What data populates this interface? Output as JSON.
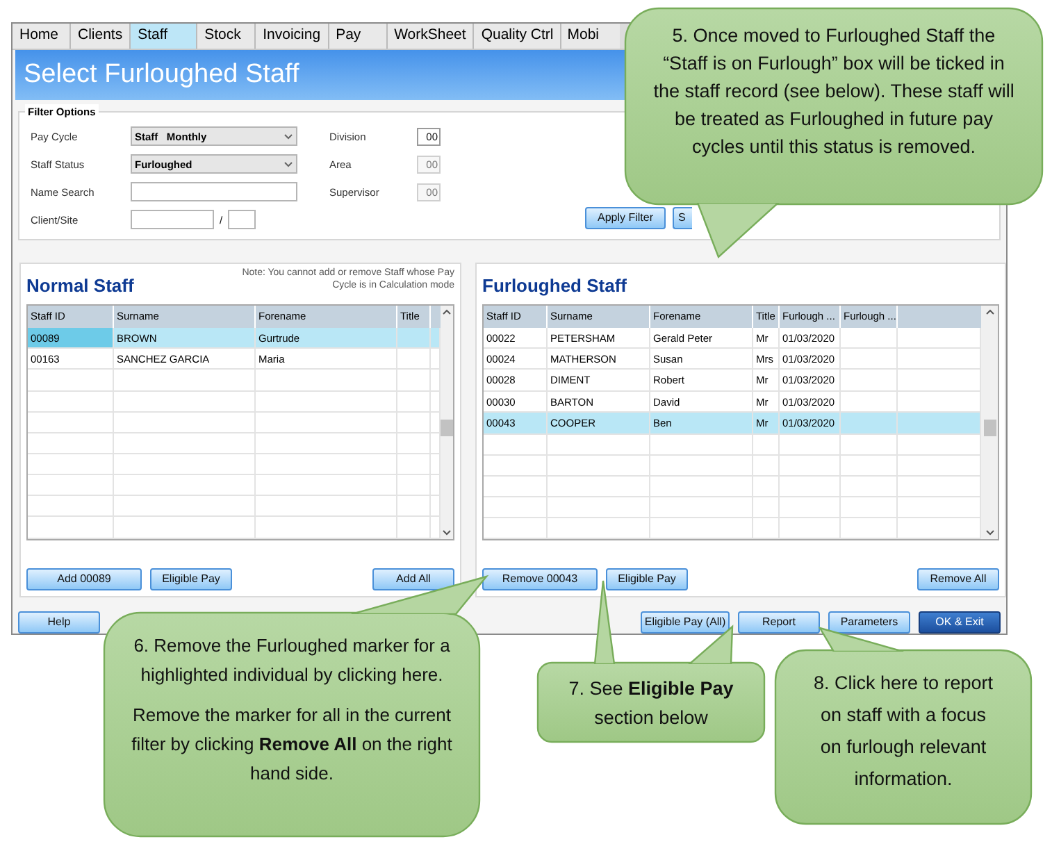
{
  "tabs": [
    {
      "label": "Home",
      "selected": false
    },
    {
      "label": "Clients",
      "selected": false
    },
    {
      "label": "Staff",
      "selected": true
    },
    {
      "label": "Stock",
      "selected": false
    },
    {
      "label": "Invoicing",
      "selected": false
    },
    {
      "label": "Pay",
      "selected": false
    },
    {
      "label": "WorkSheet",
      "selected": false
    },
    {
      "label": "Quality Ctrl",
      "selected": false
    },
    {
      "label": "Mobi",
      "selected": false
    }
  ],
  "header": {
    "title": "Select Furloughed Staff"
  },
  "filter": {
    "legend": "Filter Options",
    "left_fields": [
      {
        "label": "Pay Cycle",
        "kind": "select",
        "value": "Staff   Monthly"
      },
      {
        "label": "Staff Status",
        "kind": "select",
        "value": "Furloughed"
      },
      {
        "label": "Name Search",
        "kind": "text"
      },
      {
        "label": "Client/Site",
        "kind": "pair",
        "separator": "/"
      }
    ],
    "right_fields": [
      {
        "label": "Division",
        "value": "00",
        "disabled": false
      },
      {
        "label": "Area",
        "value": "00",
        "disabled": true
      },
      {
        "label": "Supervisor",
        "value": "00",
        "disabled": true
      }
    ],
    "buttons": [
      "Apply Filter",
      "S"
    ]
  },
  "normal_staff": {
    "title": "Normal Staff",
    "note": "Note: You cannot add or remove Staff whose Pay Cycle is in Calculation mode",
    "columns": [
      "Staff ID",
      "Surname",
      "Forename",
      "Title"
    ],
    "rows": [
      {
        "cells": [
          "00089",
          "BROWN",
          "Gurtrude",
          ""
        ],
        "selected": true
      },
      {
        "cells": [
          "00163",
          "SANCHEZ GARCIA",
          "Maria",
          ""
        ],
        "selected": false
      }
    ],
    "left_buttons": [
      "Add 00089",
      "Eligible Pay"
    ],
    "right_buttons": [
      "Add All"
    ]
  },
  "furloughed_staff": {
    "title": "Furloughed Staff",
    "columns": [
      "Staff ID",
      "Surname",
      "Forename",
      "Title",
      "Furlough ...",
      "Furlough ..."
    ],
    "rows": [
      {
        "cells": [
          "00022",
          "PETERSHAM",
          "Gerald Peter",
          "Mr",
          "01/03/2020",
          ""
        ],
        "selected": false
      },
      {
        "cells": [
          "00024",
          "MATHERSON",
          "Susan",
          "Mrs",
          "01/03/2020",
          ""
        ],
        "selected": false
      },
      {
        "cells": [
          "00028",
          "DIMENT",
          "Robert",
          "Mr",
          "01/03/2020",
          ""
        ],
        "selected": false
      },
      {
        "cells": [
          "00030",
          "BARTON",
          "David",
          "Mr",
          "01/03/2020",
          ""
        ],
        "selected": false
      },
      {
        "cells": [
          "00043",
          "COOPER",
          "Ben",
          "Mr",
          "01/03/2020",
          ""
        ],
        "selected": true
      }
    ],
    "left_buttons": [
      "Remove 00043",
      "Eligible Pay"
    ],
    "right_buttons": [
      "Remove All"
    ]
  },
  "footer": {
    "left_buttons": [
      {
        "label": "Help",
        "kind": "normal"
      }
    ],
    "right_buttons": [
      {
        "label": "Eligible Pay (All)",
        "kind": "normal"
      },
      {
        "label": "Report",
        "kind": "normal"
      },
      {
        "label": "Parameters",
        "kind": "normal"
      },
      {
        "label": "OK & Exit",
        "kind": "primary"
      }
    ]
  },
  "callouts": [
    {
      "paragraphs": [
        "5. Once moved to Furloughed Staff the “Staff is on Furlough” box will be ticked in the staff record (see below). These staff will be treated as Furloughed in future pay cycles until this status is removed."
      ]
    },
    {
      "paragraphs": [
        "6. Remove the Furloughed marker for a highlighted individual by clicking here.",
        "Remove the marker for all in the current filter by clicking **Remove All** on the right hand side."
      ]
    },
    {
      "paragraphs": [
        "7. See **Eligible Pay** section below"
      ]
    },
    {
      "paragraphs": [
        "8. Click here to report on staff with a focus on furlough relevant information."
      ]
    }
  ]
}
